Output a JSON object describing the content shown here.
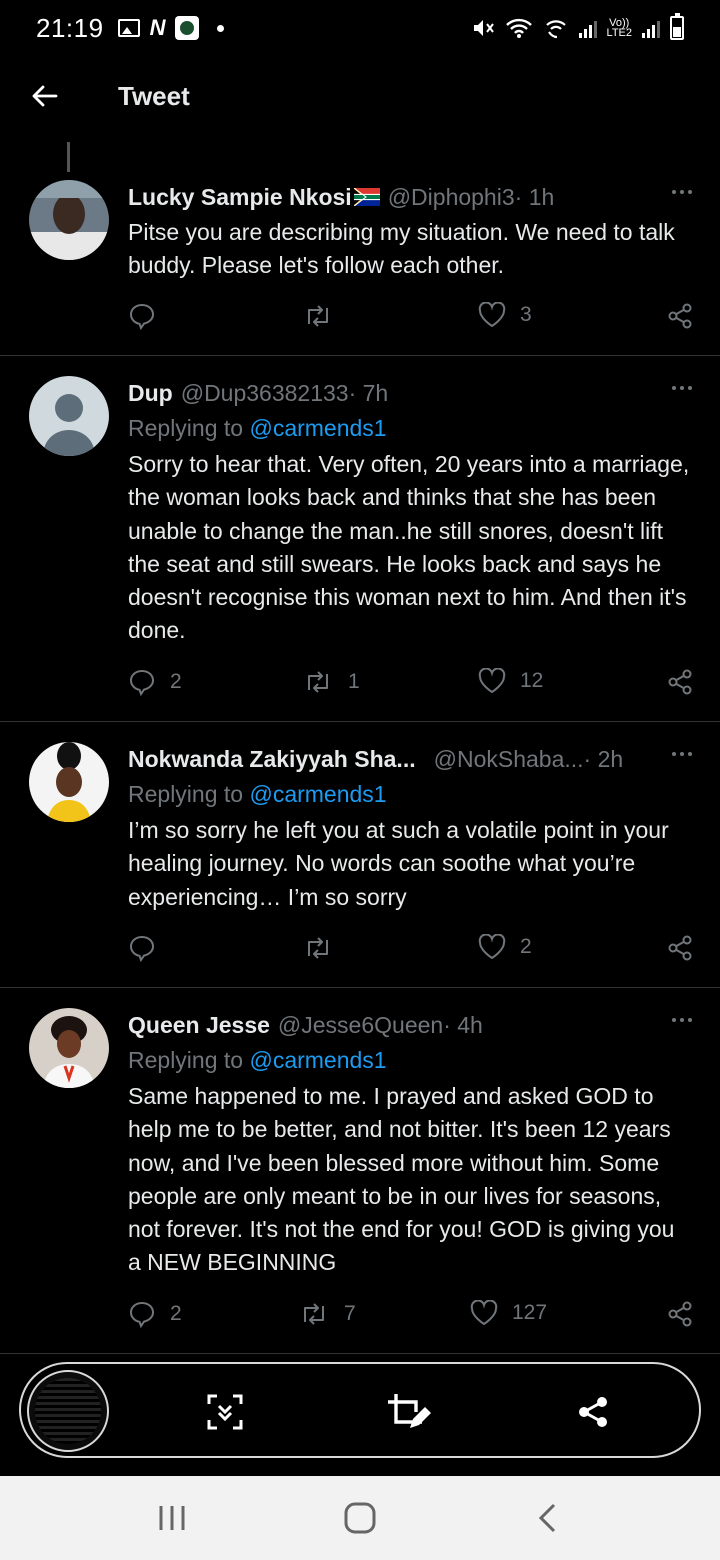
{
  "status_bar": {
    "time": "21:19",
    "volte": "Vo))",
    "lte": "LTE2"
  },
  "header": {
    "title": "Tweet"
  },
  "tweets": [
    {
      "name": "Lucky Sampie Nkosi",
      "handle": "@Diphophi3",
      "time": " · 1h",
      "replying_prefix": "",
      "mention": "",
      "text": "Pitse you are describing my situation. We need to talk buddy. Please let's follow each other.",
      "replies": "",
      "retweets": "",
      "likes": "3"
    },
    {
      "name": "Dup",
      "handle": "@Dup36382133",
      "time": " · 7h",
      "replying_prefix": "Replying to ",
      "mention": "@carmends1",
      "text": "Sorry to hear that. Very often, 20 years into a marriage, the woman looks back and thinks that she has been unable to change the man..he still snores, doesn't lift the seat and still swears. He looks back and says he doesn't recognise this woman next to him. And then it's done.",
      "replies": "2",
      "retweets": "1",
      "likes": "12"
    },
    {
      "name": "Nokwanda Zakiyyah Sha...",
      "handle": "@NokShaba...",
      "time": " · 2h",
      "replying_prefix": "Replying to ",
      "mention": "@carmends1",
      "text": "I’m so sorry he left you at such a volatile point in your healing journey. No words can soothe what you’re experiencing… I’m so sorry",
      "replies": "",
      "retweets": "",
      "likes": "2"
    },
    {
      "name": "Queen Jesse",
      "handle": "@Jesse6Queen",
      "time": " · 4h",
      "replying_prefix": "Replying to ",
      "mention": "@carmends1",
      "text": "Same happened to me. I prayed and asked GOD to help me to be better, and not bitter. It's been 12 years now, and I've been blessed more without him. Some people are only meant to be in our lives for seasons, not forever. It's not the end for you! GOD is giving you a NEW BEGINNING",
      "replies": "2",
      "retweets": "7",
      "likes": "127"
    }
  ],
  "colors": {
    "background": "#000000",
    "text": "#e7e9ea",
    "secondary": "#71767b",
    "accent": "#1d9bf0",
    "divider": "#2f3336"
  },
  "icons": {
    "back": "arrow-left-icon",
    "more": "more-icon",
    "reply": "reply-icon",
    "retweet": "retweet-icon",
    "like": "heart-icon",
    "share": "share-icon",
    "scroll_capture": "scroll-capture-icon",
    "crop_edit": "crop-edit-icon",
    "nav_recents": "recents-icon",
    "nav_home": "home-icon",
    "nav_back": "nav-back-icon"
  }
}
